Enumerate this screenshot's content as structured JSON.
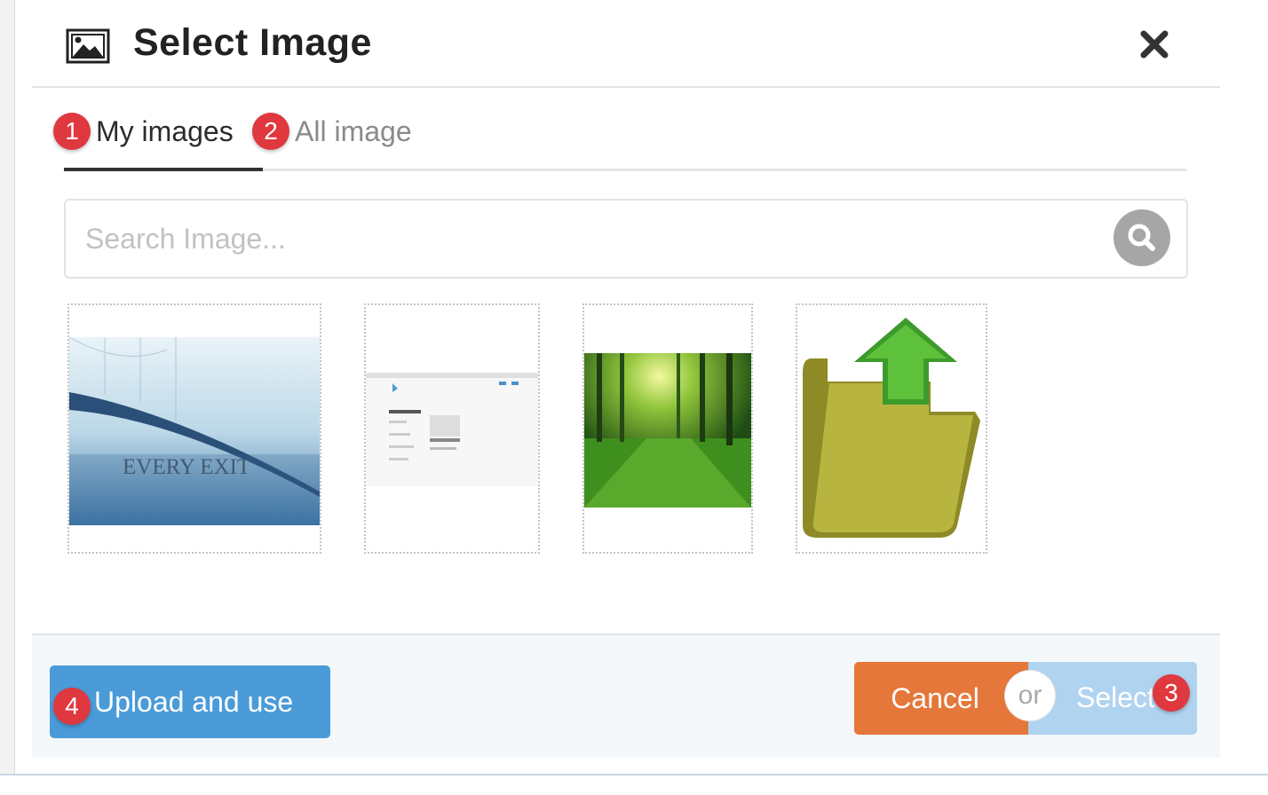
{
  "dialog": {
    "title": "Select Image",
    "title_icon": "image-icon",
    "close_icon": "close-icon"
  },
  "tabs": [
    {
      "badge": "1",
      "label": "My images",
      "active": true
    },
    {
      "badge": "2",
      "label": "All image",
      "active": false
    }
  ],
  "search": {
    "placeholder": "Search Image...",
    "value": "",
    "icon": "search-icon"
  },
  "images": [
    {
      "name": "bridge-photo",
      "caption": "EVERY EXIT"
    },
    {
      "name": "webpage-screenshot"
    },
    {
      "name": "forest-photo"
    },
    {
      "name": "folder-upload-icon"
    }
  ],
  "footer": {
    "upload": {
      "badge": "4",
      "label": "Upload and use"
    },
    "cancel_label": "Cancel",
    "or_label": "or",
    "select": {
      "label": "Select",
      "badge": "3"
    }
  },
  "colors": {
    "badge": "#e0383f",
    "upload": "#4a9bd8",
    "cancel": "#e5773a",
    "select_disabled": "#b0d3f0"
  }
}
